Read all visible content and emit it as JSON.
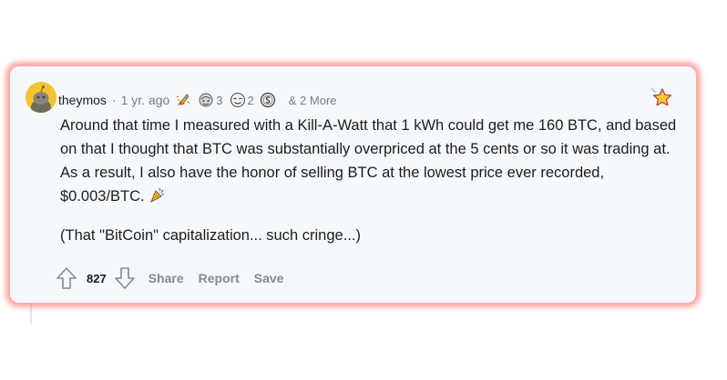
{
  "comment": {
    "username": "theymos",
    "separator": "·",
    "age": "1 yr. ago",
    "awards": [
      {
        "icon": "rocket-like-award-icon",
        "count": ""
      },
      {
        "icon": "helpful-award-icon",
        "count": "3"
      },
      {
        "icon": "wholesome-award-icon",
        "count": "2"
      },
      {
        "icon": "silver-coin-award-icon",
        "count": ""
      }
    ],
    "more_awards": "& 2 More",
    "paragraphs": [
      "Around that time I measured with a Kill-A-Watt that 1 kWh could get me 160 BTC, and based on that I thought that BTC was substantially overpriced at the 5 cents or so it was trading at. As a result, I also have the honor of selling BTC at the lowest price ever recorded, $0.003/BTC.",
      "(That \"BitCoin\" capitalization... such cringe...)"
    ],
    "score": "827",
    "actions": {
      "share": "Share",
      "report": "Report",
      "save": "Save"
    }
  },
  "colors": {
    "card_background": "#f6f9fc",
    "card_glow": "#ff5a5a",
    "avatar": "#f4c430",
    "muted_text": "#7c7c7c",
    "action_text": "#878a8c"
  }
}
